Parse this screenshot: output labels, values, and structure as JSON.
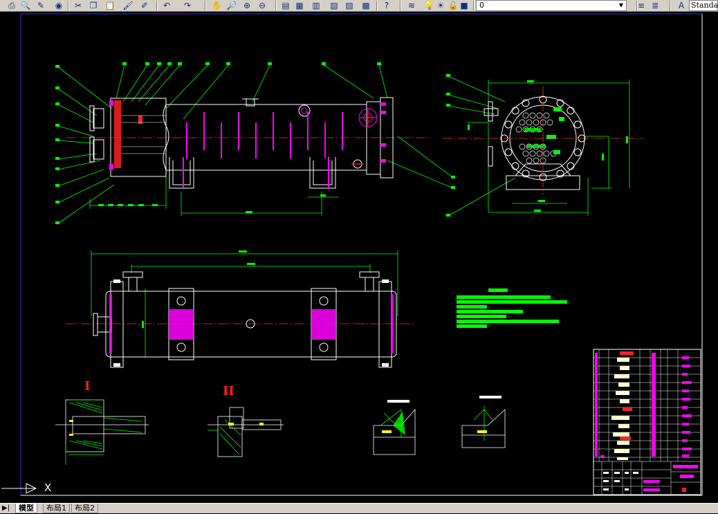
{
  "toolbar": {
    "buttons": [
      {
        "name": "print-icon",
        "glyph": "⎙"
      },
      {
        "name": "print-preview-icon",
        "glyph": "🔍"
      },
      {
        "name": "publish-icon",
        "glyph": "✎"
      },
      {
        "name": "plot-icon",
        "glyph": "◉"
      },
      {
        "name": "cut-icon",
        "glyph": "✂"
      },
      {
        "name": "copy-icon",
        "glyph": "❐"
      },
      {
        "name": "paste-icon",
        "glyph": "📋"
      },
      {
        "name": "match-properties-icon",
        "glyph": "🖌"
      },
      {
        "name": "block-editor-icon",
        "glyph": "✐"
      },
      {
        "name": "undo-icon",
        "glyph": "↶"
      },
      {
        "name": "redo-icon",
        "glyph": "↷"
      },
      {
        "name": "pan-icon",
        "glyph": "✋"
      },
      {
        "name": "zoom-realtime-icon",
        "glyph": "🔎"
      },
      {
        "name": "zoom-window-icon",
        "glyph": "⊕"
      },
      {
        "name": "zoom-previous-icon",
        "glyph": "⊖"
      },
      {
        "name": "properties-icon",
        "glyph": "▤"
      },
      {
        "name": "design-center-icon",
        "glyph": "▦"
      },
      {
        "name": "tool-palettes-icon",
        "glyph": "▥"
      },
      {
        "name": "sheet-set-icon",
        "glyph": "▧"
      },
      {
        "name": "markup-icon",
        "glyph": "▨"
      },
      {
        "name": "calculator-icon",
        "glyph": "▩"
      },
      {
        "name": "help-icon",
        "glyph": "?"
      },
      {
        "name": "layer-manager-icon",
        "glyph": "≋"
      },
      {
        "name": "layer-on-icon",
        "glyph": "💡"
      },
      {
        "name": "layer-freeze-icon",
        "glyph": "☀"
      },
      {
        "name": "layer-lock-icon",
        "glyph": "🔓"
      },
      {
        "name": "layer-color-icon",
        "glyph": "■"
      }
    ],
    "layer_value": "0",
    "layer_prev_icon": "layer-previous-icon",
    "text_style_icon": "text-style-icon",
    "text_style_value": "Standard"
  },
  "drawing": {
    "roman_numeral_1": "I",
    "roman_numeral_2": "II",
    "ucs_x_label": "X"
  },
  "tabs": {
    "model": "模型",
    "layout1": "布局1",
    "layout2": "布局2"
  },
  "colors": {
    "background": "#000000",
    "outline": "#ffffff",
    "dimension": "#00ff00",
    "accent_magenta": "#ff00ff",
    "accent_red": "#ff2020",
    "frame_blue": "#3030ff",
    "centerline": "#ff3030"
  }
}
